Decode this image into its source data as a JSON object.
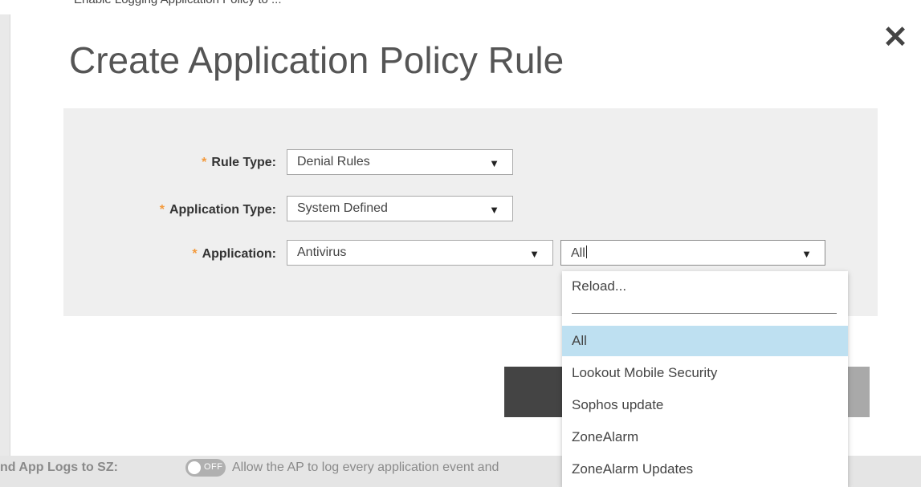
{
  "background": {
    "top_text": "Enable Logging Application Policy to ...",
    "send_logs_label": "nd App Logs to SZ:",
    "toggle_label": "OFF",
    "send_logs_description": "Allow the AP to log every application event and"
  },
  "modal": {
    "title": "Create Application Policy Rule",
    "close_glyph": "✕",
    "required_mark": "*",
    "fields": {
      "rule_type": {
        "label": "Rule Type:",
        "value": "Denial Rules"
      },
      "application_type": {
        "label": "Application Type:",
        "value": "System Defined"
      },
      "application": {
        "label": "Application:",
        "value": "Antivirus"
      },
      "application_filter": {
        "value": "All"
      }
    },
    "caret_glyph": "▼"
  },
  "dropdown": {
    "reload_label": "Reload...",
    "options": [
      "All",
      "Lookout Mobile Security",
      "Sophos update",
      "ZoneAlarm",
      "ZoneAlarm Updates"
    ],
    "selected": "All"
  },
  "colors": {
    "required": "#f39a3c",
    "selected_option": "#bee0f1",
    "button_dark": "#444444"
  }
}
